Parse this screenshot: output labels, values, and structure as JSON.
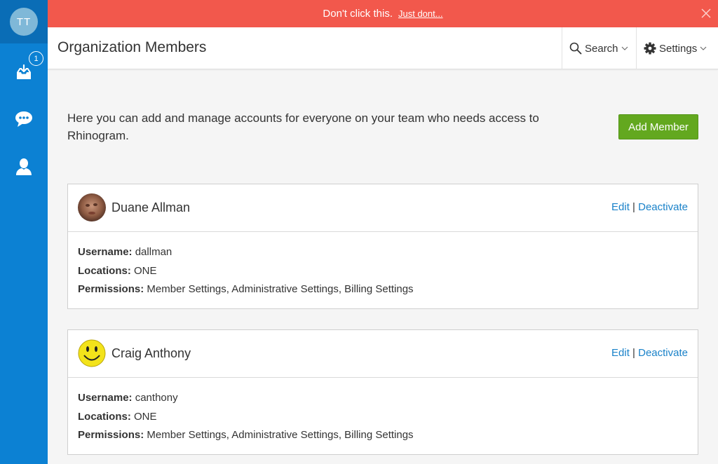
{
  "sidebar": {
    "avatar_initials": "TT",
    "items": [
      {
        "icon": "inbox-icon",
        "badge": "1"
      },
      {
        "icon": "chat-icon"
      },
      {
        "icon": "user-icon"
      }
    ]
  },
  "banner": {
    "message": "Don't click this.",
    "link": "Just dont...",
    "color": "#f2584c"
  },
  "header": {
    "title": "Organization Members",
    "search_label": "Search",
    "settings_label": "Settings"
  },
  "main": {
    "intro": "Here you can add and manage accounts for everyone on your team who needs access to Rhinogram.",
    "add_button": "Add Member",
    "labels": {
      "username": "Username:",
      "locations": "Locations:",
      "permissions": "Permissions:"
    },
    "edit_label": "Edit",
    "separator": "|",
    "deactivate_label": "Deactivate",
    "members": [
      {
        "name": "Duane Allman",
        "username": "dallman",
        "locations": "ONE",
        "permissions": "Member Settings, Administrative Settings, Billing Settings",
        "avatar": "photo"
      },
      {
        "name": "Craig Anthony",
        "username": "canthony",
        "locations": "ONE",
        "permissions": "Member Settings, Administrative Settings, Billing Settings",
        "avatar": "smiley-icon"
      }
    ]
  },
  "colors": {
    "sidebar": "#0c81d3",
    "accent_link": "#1a82c9",
    "add_button": "#63a81f"
  }
}
